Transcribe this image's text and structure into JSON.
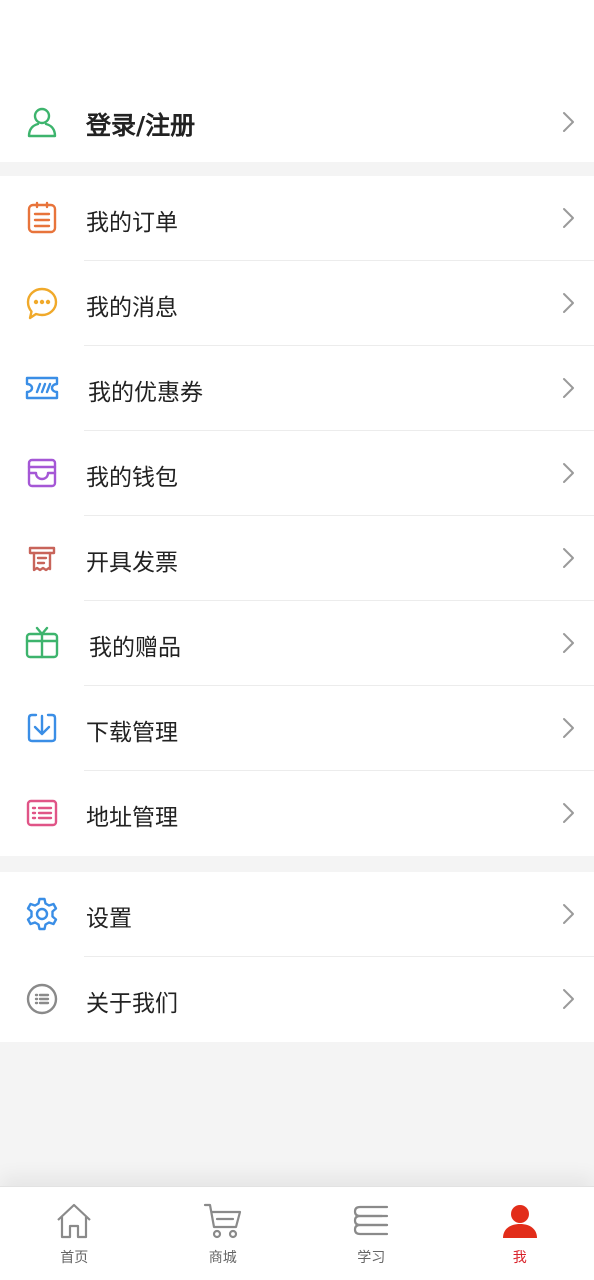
{
  "login": {
    "label": "登录/注册",
    "icon": "user-outline-icon",
    "color": "#3db46d"
  },
  "menu_group_1": [
    {
      "id": "orders",
      "label": "我的订单",
      "icon": "order-list-icon",
      "color": "#e8743b"
    },
    {
      "id": "messages",
      "label": "我的消息",
      "icon": "message-bubble-icon",
      "color": "#f0a92a"
    },
    {
      "id": "coupons",
      "label": "我的优惠券",
      "icon": "coupon-ticket-icon",
      "color": "#3a8ee6"
    },
    {
      "id": "wallet",
      "label": "我的钱包",
      "icon": "wallet-icon",
      "color": "#a557d6"
    },
    {
      "id": "invoice",
      "label": "开具发票",
      "icon": "invoice-icon",
      "color": "#c8645a"
    },
    {
      "id": "gifts",
      "label": "我的赠品",
      "icon": "gift-box-icon",
      "color": "#3db46d"
    },
    {
      "id": "downloads",
      "label": "下载管理",
      "icon": "download-icon",
      "color": "#3a8ee6"
    },
    {
      "id": "address",
      "label": "地址管理",
      "icon": "address-list-icon",
      "color": "#e05487"
    }
  ],
  "menu_group_2": [
    {
      "id": "settings",
      "label": "设置",
      "icon": "gear-icon",
      "color": "#3a8ee6"
    },
    {
      "id": "about",
      "label": "关于我们",
      "icon": "about-list-icon",
      "color": "#8a8a8a"
    }
  ],
  "tabbar": {
    "items": [
      {
        "id": "home",
        "label": "首页",
        "icon": "home-icon",
        "active": false
      },
      {
        "id": "mall",
        "label": "商城",
        "icon": "cart-icon",
        "active": false
      },
      {
        "id": "study",
        "label": "学习",
        "icon": "books-icon",
        "active": false
      },
      {
        "id": "me",
        "label": "我",
        "icon": "user-filled-icon",
        "active": true
      }
    ],
    "active_color": "#d9222a",
    "inactive_color": "#8a8a8a"
  }
}
